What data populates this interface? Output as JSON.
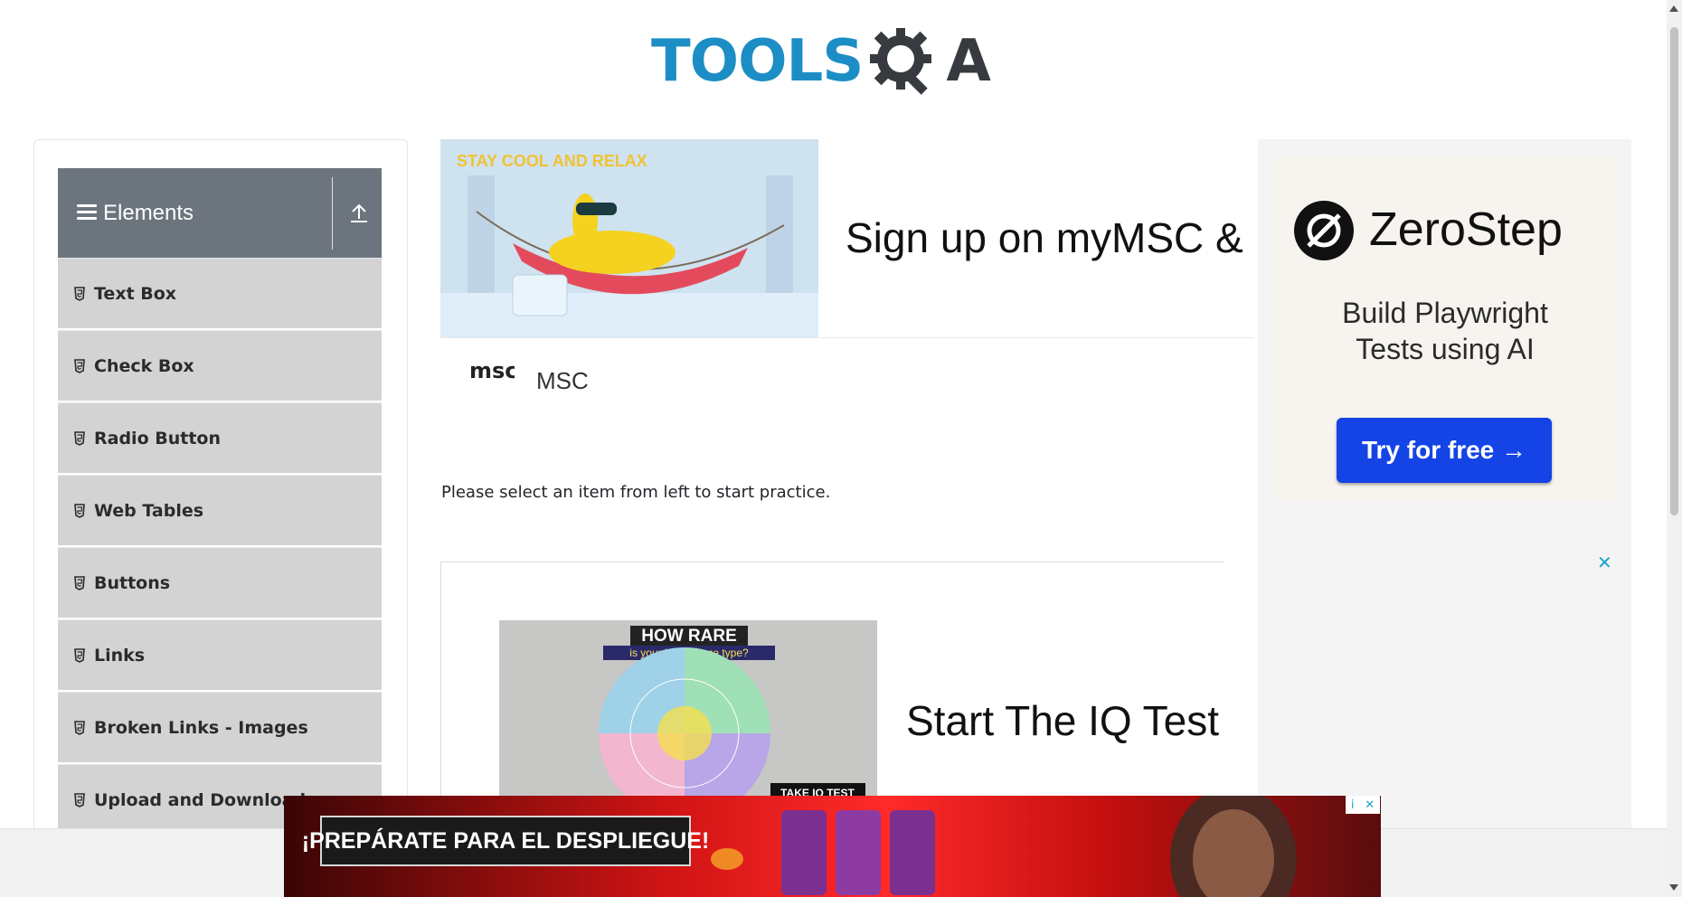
{
  "logo": {
    "text_main": "TOOLS",
    "text_end": "A",
    "alt": "TOOLSQA"
  },
  "sidebar": {
    "group_title": "Elements",
    "items": [
      {
        "label": "Text Box"
      },
      {
        "label": "Check Box"
      },
      {
        "label": "Radio Button"
      },
      {
        "label": "Web Tables"
      },
      {
        "label": "Buttons"
      },
      {
        "label": "Links"
      },
      {
        "label": "Broken Links - Images"
      },
      {
        "label": "Upload and Download"
      }
    ]
  },
  "main": {
    "ad_top": {
      "image_text": "STAY COOL AND RELAX",
      "title": "Sign up on myMSC & B",
      "brand_logo": "msc",
      "brand_name": "MSC"
    },
    "instruction": "Please select an item from left to start practice.",
    "ad_iq": {
      "image_title": "HOW RARE",
      "image_subtitle": "is your intelligence type?",
      "image_cta": "TAKE IQ TEST",
      "title": "Start The IQ Test"
    }
  },
  "right_ad": {
    "brand": "ZeroStep",
    "tagline_line1": "Build Playwright",
    "tagline_line2": "Tests using AI",
    "cta": "Try for free →",
    "close": "✕"
  },
  "bottom_ad": {
    "promo": "¡PREPÁRATE PARA EL DESPLIEGUE!",
    "choices_info": "i",
    "choices_close": "✕"
  },
  "colors": {
    "logo_blue": "#1c8ec5",
    "logo_dark": "#373b3f",
    "sidebar_header": "#6c757d",
    "menu_item_bg": "#d3d3d3",
    "cta_blue": "#1443e6",
    "bottom_ad_red": "#d11414"
  },
  "icons": {
    "menu": "hamburger-icon",
    "collapse": "upload-arrow-icon",
    "menu_item": "html5-icon",
    "zerostep": "zerostep-logo-icon"
  }
}
